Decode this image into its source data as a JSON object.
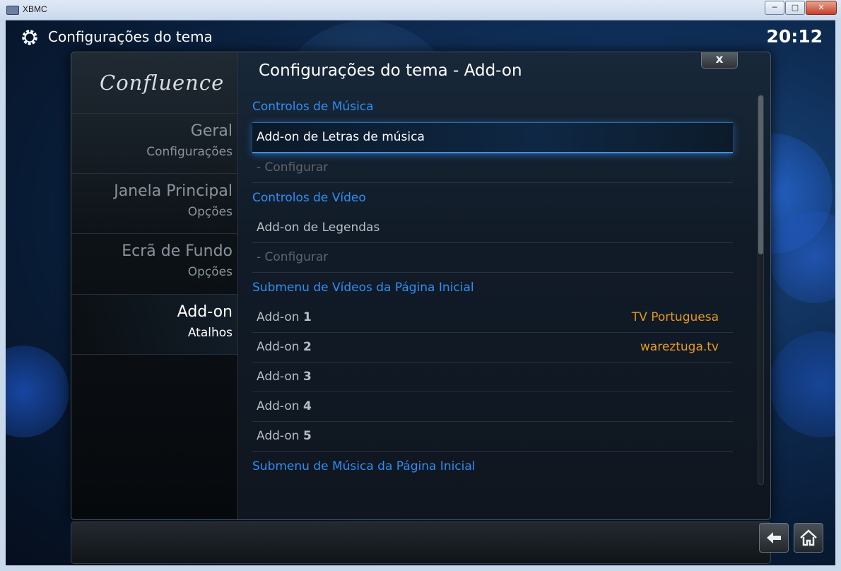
{
  "window": {
    "title": "XBMC",
    "controls": [
      "─",
      "□",
      "✕"
    ]
  },
  "header": {
    "title": "Configurações do tema",
    "clock": "20:12",
    "icon": "gear-icon"
  },
  "dialog": {
    "logo": "Confluence",
    "title": "Configurações do tema - Add-on",
    "close_label": "x",
    "categories": [
      {
        "label": "Geral",
        "sub": "Configurações",
        "active": false
      },
      {
        "label": "Janela Principal",
        "sub": "Opções",
        "active": false
      },
      {
        "label": "Ecrã de Fundo",
        "sub": "Opções",
        "active": false
      },
      {
        "label": "Add-on",
        "sub": "Atalhos",
        "active": true
      }
    ],
    "rows": [
      {
        "kind": "header",
        "label": "Controlos de Música"
      },
      {
        "kind": "item",
        "label": "Add-on de Letras de música",
        "focused": true
      },
      {
        "kind": "item",
        "label": "- Configurar",
        "disabled": true
      },
      {
        "kind": "header",
        "label": "Controlos de Vídeo"
      },
      {
        "kind": "item",
        "label": "Add-on de Legendas"
      },
      {
        "kind": "item",
        "label": "- Configurar",
        "disabled": true
      },
      {
        "kind": "header",
        "label": "Submenu de Vídeos da Página Inicial"
      },
      {
        "kind": "item",
        "label": "Add-on",
        "num": "1",
        "value": "TV Portuguesa"
      },
      {
        "kind": "item",
        "label": "Add-on",
        "num": "2",
        "value": "wareztuga.tv"
      },
      {
        "kind": "item",
        "label": "Add-on",
        "num": "3"
      },
      {
        "kind": "item",
        "label": "Add-on",
        "num": "4"
      },
      {
        "kind": "item",
        "label": "Add-on",
        "num": "5"
      },
      {
        "kind": "header",
        "label": "Submenu de Música da Página Inicial"
      }
    ]
  },
  "bottom": {
    "buttons": [
      "back-icon",
      "home-icon"
    ]
  },
  "colors": {
    "accent_blue": "#2f8ef4",
    "value_orange": "#e69a1f"
  }
}
